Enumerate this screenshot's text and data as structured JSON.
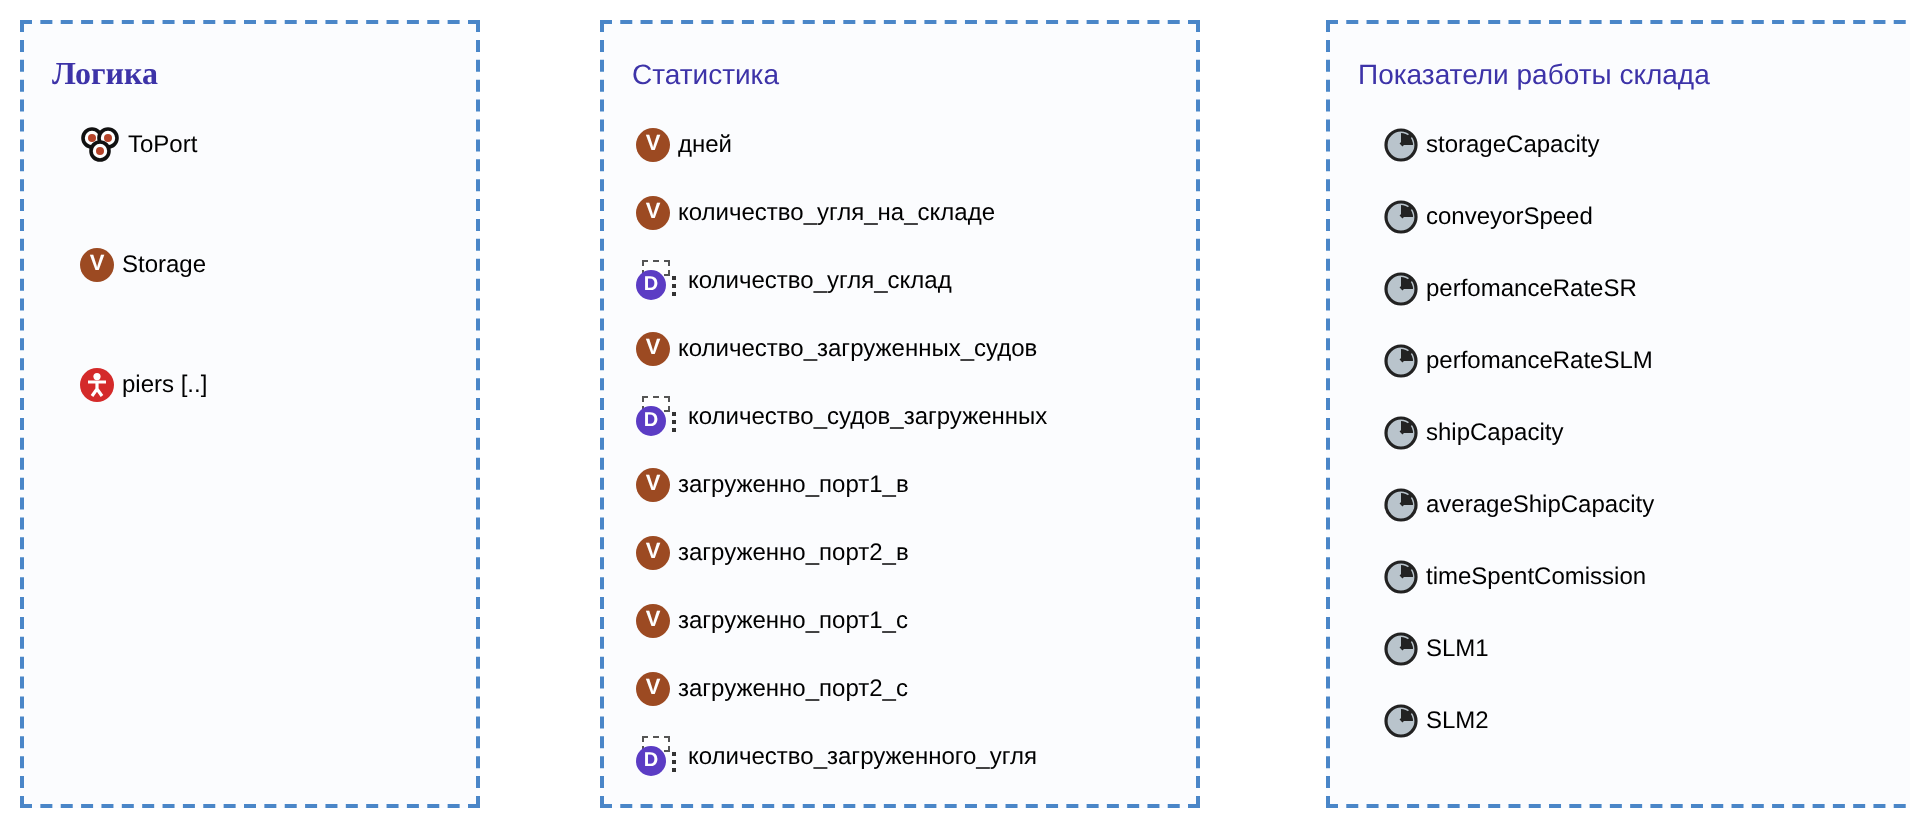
{
  "panels": [
    {
      "title": "Логика",
      "kind": "classic",
      "items": [
        {
          "kind": "agent",
          "label": "ToPort"
        },
        {
          "kind": "variable",
          "glyph": "V",
          "label": "Storage"
        },
        {
          "kind": "population",
          "label": "piers [..]"
        }
      ]
    },
    {
      "title": "Статистика",
      "kind": "plain",
      "items": [
        {
          "kind": "variable",
          "glyph": "V",
          "label": "дней"
        },
        {
          "kind": "variable",
          "glyph": "V",
          "label": "количество_угля_на_складе"
        },
        {
          "kind": "dataset",
          "glyph": "D",
          "label": "количество_угля_склад"
        },
        {
          "kind": "variable",
          "glyph": "V",
          "label": "количество_загруженных_судов"
        },
        {
          "kind": "dataset",
          "glyph": "D",
          "label": "количество_судов_загруженных"
        },
        {
          "kind": "variable",
          "glyph": "V",
          "label": "загруженно_порт1_в"
        },
        {
          "kind": "variable",
          "glyph": "V",
          "label": "загруженно_порт2_в"
        },
        {
          "kind": "variable",
          "glyph": "V",
          "label": "загруженно_порт1_с"
        },
        {
          "kind": "variable",
          "glyph": "V",
          "label": "загруженно_порт2_с"
        },
        {
          "kind": "dataset",
          "glyph": "D",
          "label": "количество_загруженного_угля"
        }
      ]
    },
    {
      "title": "Показатели работы склада",
      "kind": "plain",
      "items": [
        {
          "kind": "parameter",
          "label": "storageCapacity"
        },
        {
          "kind": "parameter",
          "label": "conveyorSpeed"
        },
        {
          "kind": "parameter",
          "label": "perfomanceRateSR"
        },
        {
          "kind": "parameter",
          "label": "perfomanceRateSLM"
        },
        {
          "kind": "parameter",
          "label": "shipCapacity"
        },
        {
          "kind": "parameter",
          "label": "averageShipCapacity"
        },
        {
          "kind": "parameter",
          "label": "timeSpentComission"
        },
        {
          "kind": "parameter",
          "label": "SLM1"
        },
        {
          "kind": "parameter",
          "label": "SLM2"
        }
      ]
    }
  ]
}
